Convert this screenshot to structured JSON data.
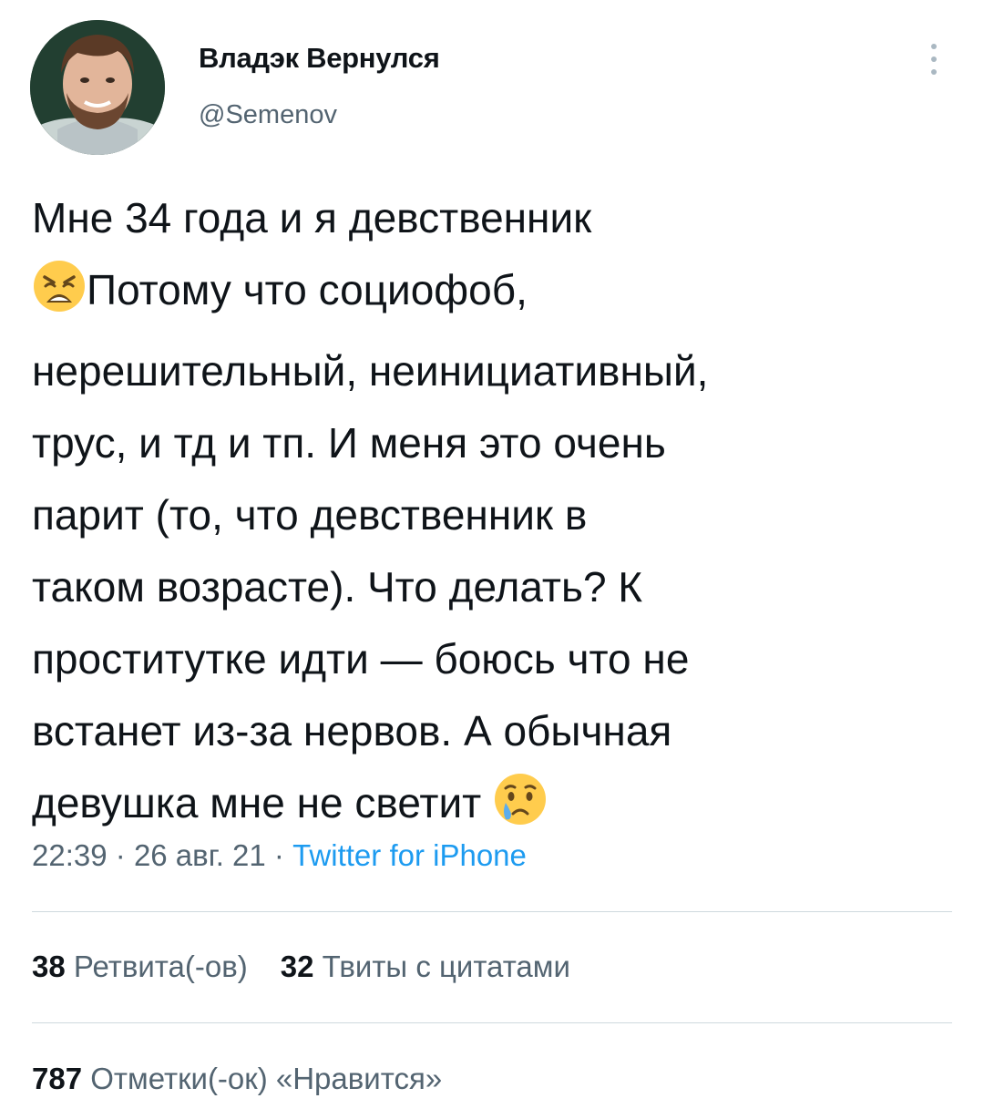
{
  "user": {
    "display_name": "Владэк Вернулся",
    "handle": "@Semenov"
  },
  "tweet": {
    "line1": "Мне 34 года и я девственник",
    "emoji1": "weary-face",
    "line2": "Потому что социофоб,",
    "line3": "нерешительный, неинициативный,",
    "line4": "трус, и тд и тп. И меня это очень",
    "line5": "парит (то, что девственник в",
    "line6": "таком возрасте). Что делать? К",
    "line7": "проститутке идти — боюсь что не",
    "line8": "встанет из-за нервов. А обычная",
    "line9": "девушка мне не светит",
    "emoji2": "crying-face"
  },
  "meta": {
    "time": "22:39",
    "sep1": "·",
    "date": "26 авг. 21",
    "sep2": "·",
    "source": "Twitter for iPhone"
  },
  "stats": {
    "retweets_count": "38",
    "retweets_label": "Ретвита(-ов)",
    "quotes_count": "32",
    "quotes_label": "Твиты с цитатами",
    "likes_count": "787",
    "likes_label": "Отметки(-ок) «Нравится»"
  },
  "colors": {
    "text": "#0f1419",
    "secondary": "#536471",
    "link": "#1d9bf0",
    "divider": "#cfd9de"
  }
}
